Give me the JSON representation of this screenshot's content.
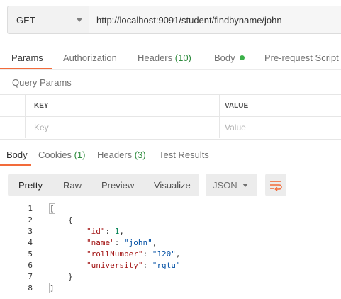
{
  "request": {
    "method": "GET",
    "url": "http://localhost:9091/student/findbyname/john"
  },
  "request_tabs": {
    "params": "Params",
    "authorization": "Authorization",
    "headers": "Headers",
    "headers_count": "(10)",
    "body": "Body",
    "prerequest": "Pre-request Script"
  },
  "query_params": {
    "title": "Query Params",
    "key_header": "KEY",
    "value_header": "VALUE",
    "key_placeholder": "Key",
    "value_placeholder": "Value"
  },
  "response_tabs": {
    "body": "Body",
    "cookies": "Cookies",
    "cookies_count": "(1)",
    "headers": "Headers",
    "headers_count": "(3)",
    "test_results": "Test Results"
  },
  "view_modes": {
    "pretty": "Pretty",
    "raw": "Raw",
    "preview": "Preview",
    "visualize": "Visualize"
  },
  "format": "JSON",
  "code": {
    "line_numbers": [
      "1",
      "2",
      "3",
      "4",
      "5",
      "6",
      "7",
      "8"
    ],
    "open_bracket": "[",
    "open_brace": "{",
    "id_key": "\"id\"",
    "id_value": "1",
    "name_key": "\"name\"",
    "name_value": "\"john\"",
    "roll_key": "\"rollNumber\"",
    "roll_value": "\"120\"",
    "university_key": "\"university\"",
    "university_value": "\"rgtu\"",
    "close_brace": "}",
    "close_bracket": "]",
    "colon": ": ",
    "comma": ","
  },
  "colors": {
    "accent": "#f26b3a",
    "status_dot": "#3cb14a",
    "json_key": "#a31515",
    "json_string": "#0451a5",
    "json_number": "#098658"
  }
}
